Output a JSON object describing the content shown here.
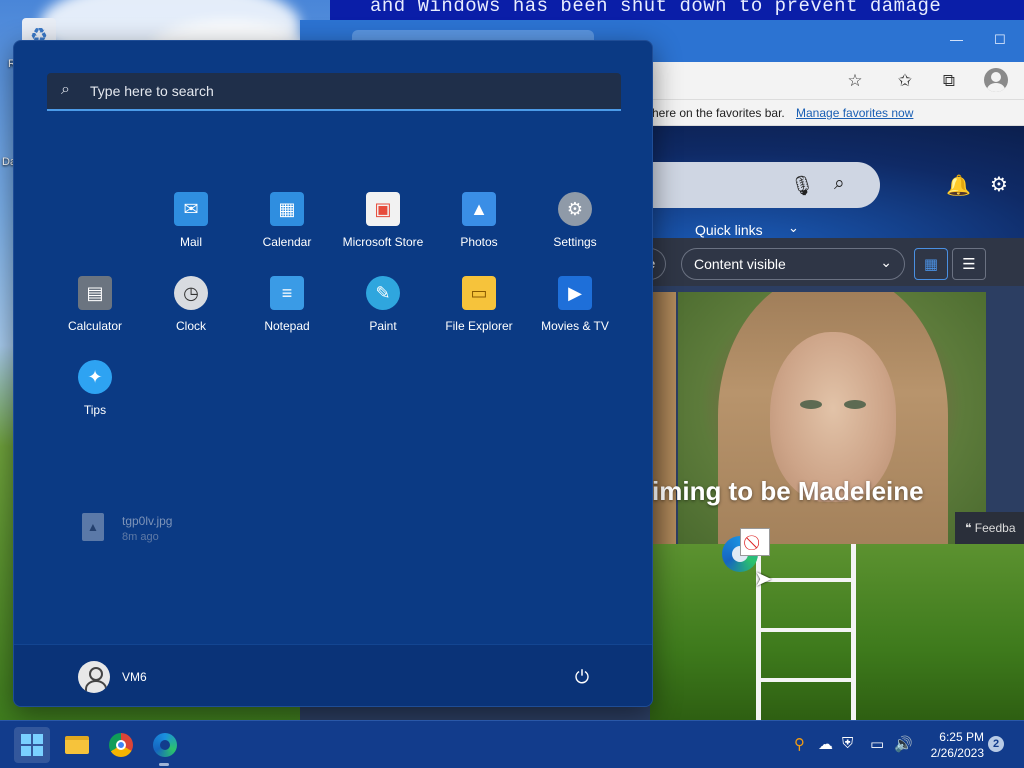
{
  "desktop": {
    "bsod_text": "and Windows has been shut down to prevent damage",
    "icon_labels": [
      "R",
      "Da"
    ]
  },
  "browser": {
    "favorites_text": "here on the favorites bar.",
    "favorites_link": "Manage favorites now",
    "quick_links": "Quick links",
    "filter_partial": "e",
    "content_dropdown": "Content visible",
    "headline_partial": "iming to be Madeleine",
    "feedback_label": "Feedba"
  },
  "start_menu": {
    "search_placeholder": "Type here to search",
    "pinned_apps": [
      {
        "label": "Mail",
        "icon": "mail-icon",
        "color": "#2f8ee0"
      },
      {
        "label": "Calendar",
        "icon": "calendar-icon",
        "color": "#2f8ee0"
      },
      {
        "label": "Microsoft Store",
        "icon": "store-icon",
        "color": "#f2f2f2"
      },
      {
        "label": "Photos",
        "icon": "photos-icon",
        "color": "#3a8ee6"
      },
      {
        "label": "Settings",
        "icon": "settings-gear-icon",
        "color": "#8f9aa8"
      },
      {
        "label": "Calculator",
        "icon": "calculator-icon",
        "color": "#6b7480"
      },
      {
        "label": "Clock",
        "icon": "clock-icon",
        "color": "#d8dbe0"
      },
      {
        "label": "Notepad",
        "icon": "notepad-icon",
        "color": "#3a9be6"
      },
      {
        "label": "Paint",
        "icon": "paint-palette-icon",
        "color": "#2fa6de"
      },
      {
        "label": "File Explorer",
        "icon": "folder-icon",
        "color": "#f6c33b"
      },
      {
        "label": "Movies & TV",
        "icon": "movies-play-icon",
        "color": "#1e6fd9"
      },
      {
        "label": "Tips",
        "icon": "tips-lightbulb-icon",
        "color": "#2ea3f2"
      }
    ],
    "recent_file": {
      "name": "tgp0lv.jpg",
      "time": "8m ago"
    },
    "user_name": "VM6"
  },
  "taskbar": {
    "clock_time": "6:25 PM",
    "clock_date": "2/26/2023",
    "notification_count": "2"
  },
  "colors": {
    "start_bg": "#0b3a84",
    "taskbar_bg": "#123c8c",
    "search_focus": "#4c9be8",
    "link": "#1a5fb4"
  }
}
